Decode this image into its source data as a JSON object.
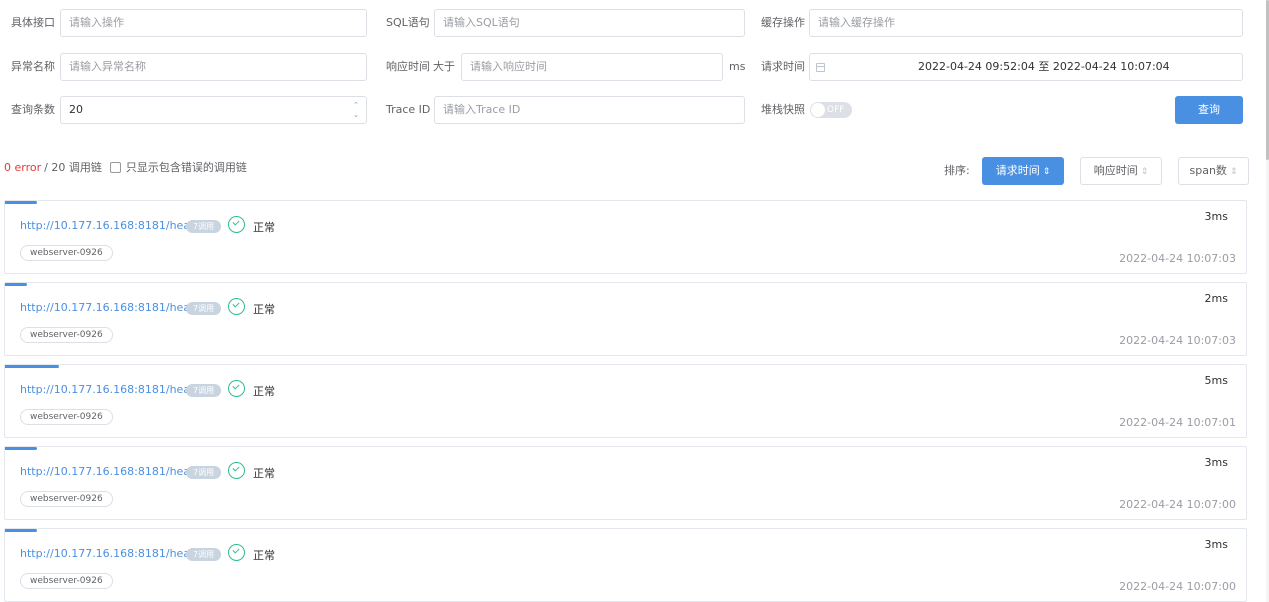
{
  "filters": {
    "interface_label": "具体接口",
    "interface_placeholder": "请输入操作",
    "sql_label": "SQL语句",
    "sql_placeholder": "请输入SQL语句",
    "cache_label": "缓存操作",
    "cache_placeholder": "请输入缓存操作",
    "exception_label": "异常名称",
    "exception_placeholder": "请输入异常名称",
    "response_label": "响应时间",
    "response_gt": "大于",
    "response_placeholder": "请输入响应时间",
    "response_unit": "ms",
    "request_time_label": "请求时间",
    "request_time_value": "2022-04-24 09:52:04 至 2022-04-24 10:07:04",
    "count_label": "查询条数",
    "count_value": "20",
    "trace_label": "Trace ID",
    "trace_placeholder": "请输入Trace ID",
    "stack_label": "堆栈快照",
    "stack_switch": "OFF",
    "query_button": "查询"
  },
  "summary": {
    "errors": "0 error",
    "rest": "/ 20 调用链",
    "only_errors_label": "只显示包含错误的调用链"
  },
  "sort": {
    "label": "排序:",
    "request_time": "请求时间",
    "response_time": "响应时间",
    "span_count": "span数"
  },
  "traces": [
    {
      "url": "http://10.177.16.168:8181/health",
      "badge": "7调用",
      "status": "正常",
      "server": "webserver-0926",
      "duration": "3ms",
      "time": "2022-04-24 10:07:03",
      "bar_fraction": 0.6
    },
    {
      "url": "http://10.177.16.168:8181/health",
      "badge": "7调用",
      "status": "正常",
      "server": "webserver-0926",
      "duration": "2ms",
      "time": "2022-04-24 10:07:03",
      "bar_fraction": 0.4
    },
    {
      "url": "http://10.177.16.168:8181/health",
      "badge": "7调用",
      "status": "正常",
      "server": "webserver-0926",
      "duration": "5ms",
      "time": "2022-04-24 10:07:01",
      "bar_fraction": 1.0
    },
    {
      "url": "http://10.177.16.168:8181/health",
      "badge": "7调用",
      "status": "正常",
      "server": "webserver-0926",
      "duration": "3ms",
      "time": "2022-04-24 10:07:00",
      "bar_fraction": 0.6
    },
    {
      "url": "http://10.177.16.168:8181/health",
      "badge": "7调用",
      "status": "正常",
      "server": "webserver-0926",
      "duration": "3ms",
      "time": "2022-04-24 10:07:00",
      "bar_fraction": 0.6
    }
  ],
  "colors": {
    "primary": "#4a90e2",
    "success": "#2cc08a",
    "error": "#e4393c"
  }
}
